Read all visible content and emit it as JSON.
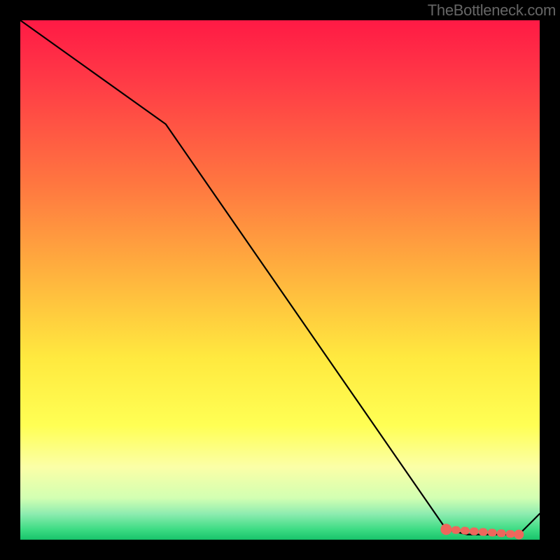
{
  "watermark": "TheBottleneck.com",
  "chart_data": {
    "type": "line",
    "title": "",
    "xlabel": "",
    "ylabel": "",
    "xlim": [
      0,
      100
    ],
    "ylim": [
      0,
      100
    ],
    "grid": false,
    "series": [
      {
        "name": "curve",
        "x": [
          0,
          28,
          82,
          86,
          96,
          100
        ],
        "values": [
          100,
          80,
          2,
          1,
          1,
          5
        ]
      }
    ],
    "markers": [
      {
        "name": "valley-start",
        "x": 82,
        "y": 2,
        "color": "#ee675c"
      },
      {
        "name": "valley-end",
        "x": 96,
        "y": 1,
        "color": "#ee675c"
      }
    ],
    "color_bands_note": "vertical background encodes value 0-100: top=red(bad) through yellow to bottom=green(good)"
  }
}
